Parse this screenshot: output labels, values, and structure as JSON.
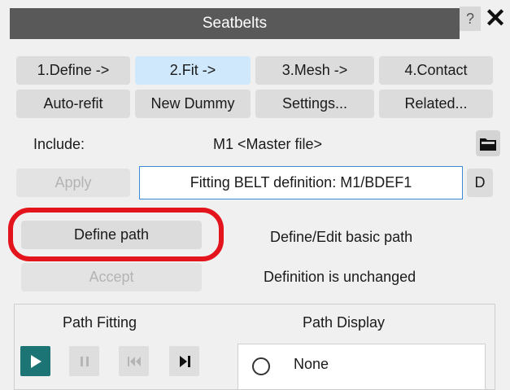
{
  "window": {
    "title": "Seatbelts",
    "help_label": "?",
    "close_label": "✕"
  },
  "tabs": [
    {
      "label": "1.Define ->"
    },
    {
      "label": "2.Fit ->",
      "active": true
    },
    {
      "label": "3.Mesh ->"
    },
    {
      "label": "4.Contact"
    }
  ],
  "toolbar": {
    "auto_refit": "Auto-refit",
    "new_dummy": "New Dummy",
    "settings": "Settings...",
    "related": "Related..."
  },
  "include": {
    "label": "Include:",
    "value": "M1  <Master file>",
    "icon": "folder-icon"
  },
  "definition": {
    "apply": "Apply",
    "field_text": "Fitting BELT definition: M1/BDEF1",
    "d_label": "D"
  },
  "path": {
    "define_button": "Define path",
    "define_desc": "Define/Edit basic path",
    "accept_button": "Accept",
    "status": "Definition is unchanged"
  },
  "fitting": {
    "path_fitting_label": "Path Fitting",
    "path_display_label": "Path Display",
    "display_option": "None",
    "controls": [
      "play-icon",
      "pause-icon",
      "skip-back-icon",
      "step-forward-icon"
    ]
  },
  "colors": {
    "accent": "#1d7475",
    "highlight": "#e3141b",
    "titlebar": "#595959",
    "active_tab": "#cfe8fb"
  }
}
